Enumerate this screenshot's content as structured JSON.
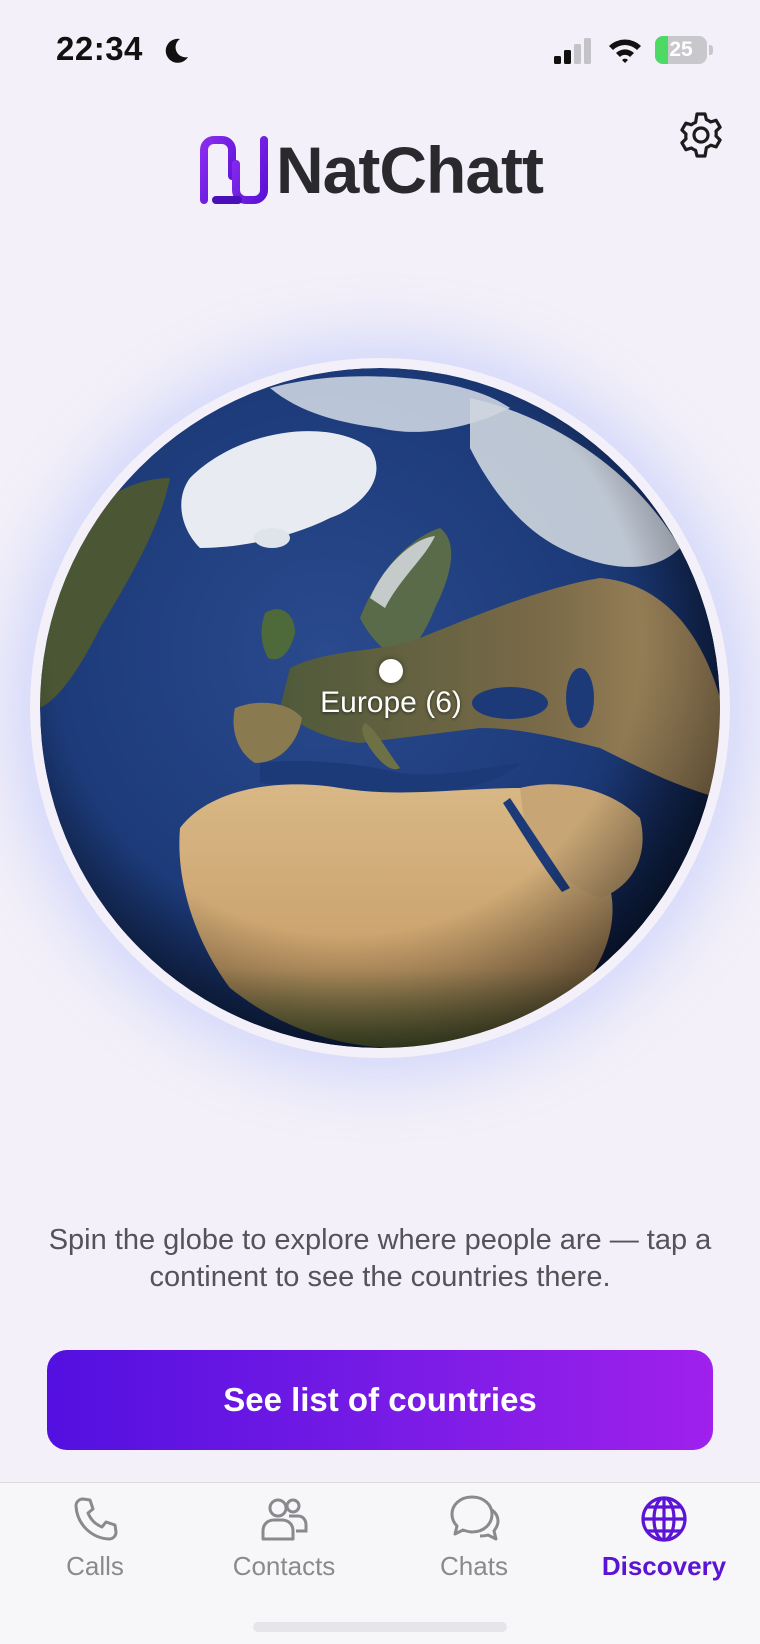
{
  "status_bar": {
    "time": "22:34",
    "battery_level": "25",
    "battery_percent": 25
  },
  "app": {
    "logo_text": "NatChatt",
    "brand_color": "#6a1de0"
  },
  "globe": {
    "marker_label": "Europe (6)"
  },
  "description": "Spin the globe to explore where people are — tap a continent to see the countries there.",
  "cta": {
    "label": "See list of countries"
  },
  "tabs": [
    {
      "label": "Calls",
      "icon": "phone-icon",
      "active": false
    },
    {
      "label": "Contacts",
      "icon": "contacts-icon",
      "active": false
    },
    {
      "label": "Chats",
      "icon": "chat-bubbles-icon",
      "active": false
    },
    {
      "label": "Discovery",
      "icon": "globe-icon",
      "active": true
    }
  ],
  "colors": {
    "active_tab": "#5b14d4",
    "inactive_tab": "#8a8a8e",
    "cta_gradient_start": "#5310e0",
    "cta_gradient_end": "#a020ec",
    "background": "#f3f0f9"
  }
}
